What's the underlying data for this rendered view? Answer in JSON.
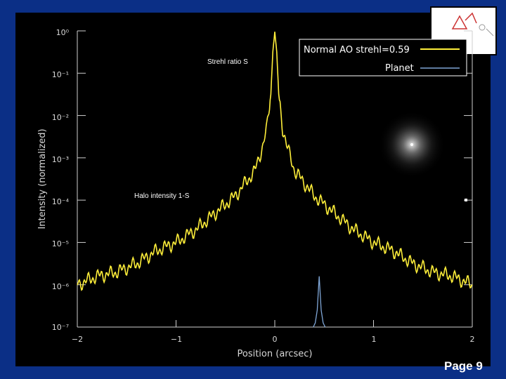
{
  "page": {
    "label": "Page 9"
  },
  "chart_data": {
    "type": "line",
    "xlabel": "Position (arcsec)",
    "ylabel": "Intensity (normalized)",
    "xlim": [
      -2,
      2
    ],
    "ylim_log10": [
      -7,
      0
    ],
    "log_y": true,
    "x_ticks": [
      "−2",
      "−1",
      "0",
      "1",
      "2"
    ],
    "y_ticks": [
      "10⁰",
      "10⁻¹",
      "10⁻²",
      "10⁻³",
      "10⁻⁴",
      "10⁻⁵",
      "10⁻⁶",
      "10⁻⁷"
    ],
    "legend_placement": "top-right",
    "series": [
      {
        "name": "Normal AO strehl=0.59",
        "color": "#ffef3a",
        "x": [
          -2.0,
          -1.8,
          -1.6,
          -1.4,
          -1.2,
          -1.0,
          -0.8,
          -0.6,
          -0.4,
          -0.3,
          -0.2,
          -0.12,
          -0.08,
          -0.04,
          -0.02,
          0.0,
          0.02,
          0.04,
          0.08,
          0.12,
          0.2,
          0.3,
          0.4,
          0.6,
          0.8,
          1.0,
          1.2,
          1.4,
          1.6,
          1.8,
          2.0
        ],
        "y_log10": [
          -6.0,
          -5.8,
          -5.7,
          -5.5,
          -5.2,
          -5.0,
          -4.7,
          -4.3,
          -3.9,
          -3.6,
          -3.3,
          -2.7,
          -2.3,
          -1.5,
          -0.5,
          -0.02,
          -0.5,
          -1.5,
          -2.3,
          -2.7,
          -3.3,
          -3.6,
          -3.9,
          -4.3,
          -4.7,
          -5.0,
          -5.2,
          -5.5,
          -5.7,
          -5.8,
          -6.0
        ]
      },
      {
        "name": "Planet",
        "color": "#7fa6d6",
        "x": [
          0.39,
          0.41,
          0.43,
          0.445,
          0.45,
          0.455,
          0.47,
          0.49,
          0.51
        ],
        "y_log10": [
          -7.0,
          -6.9,
          -6.6,
          -6.0,
          -5.8,
          -6.0,
          -6.6,
          -6.9,
          -7.0
        ]
      }
    ],
    "annotations": [
      {
        "text": "Strehl ratio S",
        "x": -0.08,
        "y_log10": -0.55
      },
      {
        "text": "Halo intensity 1-S",
        "x": -1.56,
        "y_log10": -3.95
      }
    ]
  }
}
